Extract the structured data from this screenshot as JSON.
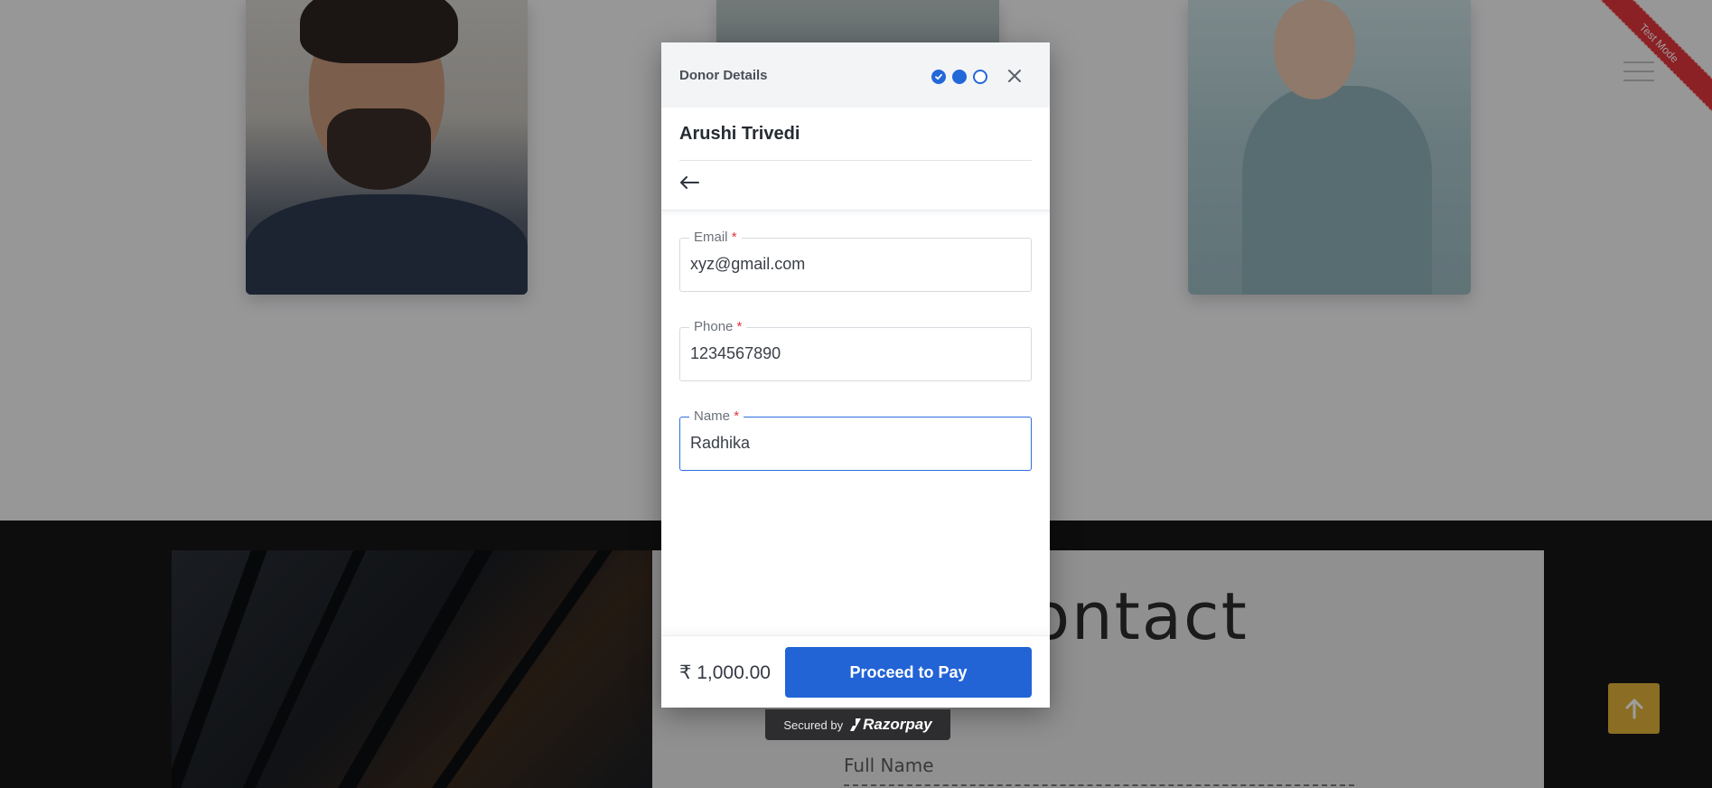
{
  "background": {
    "ribbon_text": "Test Mode",
    "contact_heading": "ontact",
    "contact_field_label": "Full Name"
  },
  "modal": {
    "header_title": "Donor Details",
    "merchant_name": "Arushi Trivedi",
    "steps": [
      "done",
      "active",
      "todo"
    ],
    "fields": {
      "email": {
        "label": "Email",
        "required_mark": "*",
        "value": "xyz@gmail.com"
      },
      "phone": {
        "label": "Phone",
        "required_mark": "*",
        "value": "1234567890"
      },
      "name": {
        "label": "Name",
        "required_mark": "*",
        "value": "Radhika"
      }
    },
    "amount": "₹ 1,000.00",
    "pay_button_label": "Proceed to Pay"
  },
  "badge": {
    "secured_text": "Secured by",
    "brand": "Razorpay"
  },
  "colors": {
    "primary": "#2263d6",
    "ribbon": "#e0343d",
    "scroll_top": "#e0b23b"
  }
}
